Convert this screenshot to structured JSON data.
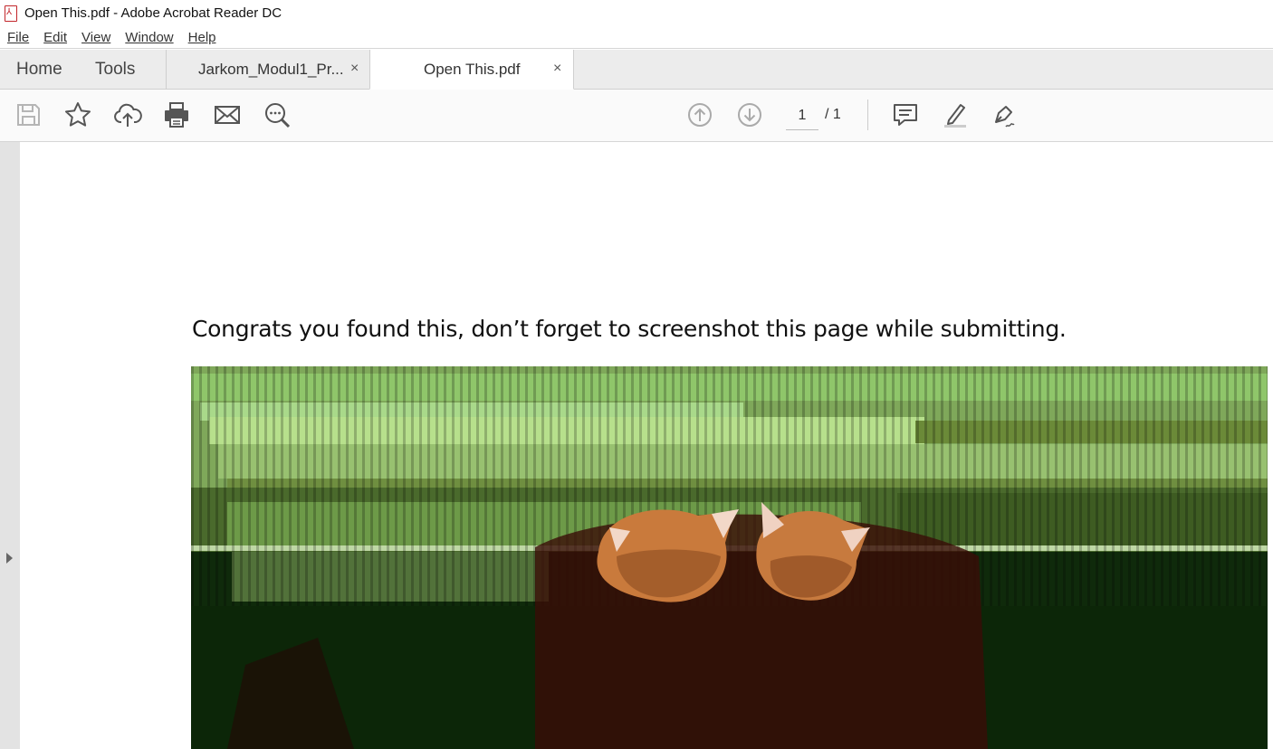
{
  "window": {
    "title": "Open This.pdf - Adobe Acrobat Reader DC"
  },
  "menu": {
    "items": [
      "File",
      "Edit",
      "View",
      "Window",
      "Help"
    ]
  },
  "nav": {
    "home": "Home",
    "tools": "Tools"
  },
  "tabs": [
    {
      "label": "Jarkom_Modul1_Pr...",
      "close": "×",
      "active": false
    },
    {
      "label": "Open This.pdf",
      "close": "×",
      "active": true
    }
  ],
  "toolbar": {
    "icons": [
      "save-icon",
      "bookmark-star-icon",
      "upload-cloud-icon",
      "print-icon",
      "email-icon",
      "zoom-search-icon",
      "previous-page-icon",
      "next-page-icon",
      "comment-icon",
      "highlight-pen-icon",
      "sign-icon"
    ],
    "page_current": "1",
    "page_total": "/ 1"
  },
  "document": {
    "text": "Congrats you found this, don’t forget to screenshot this page while submitting."
  },
  "colors": {
    "accent": "#c2252a",
    "toolbar_bg": "#fafafa",
    "tabbar_bg": "#ececec"
  }
}
